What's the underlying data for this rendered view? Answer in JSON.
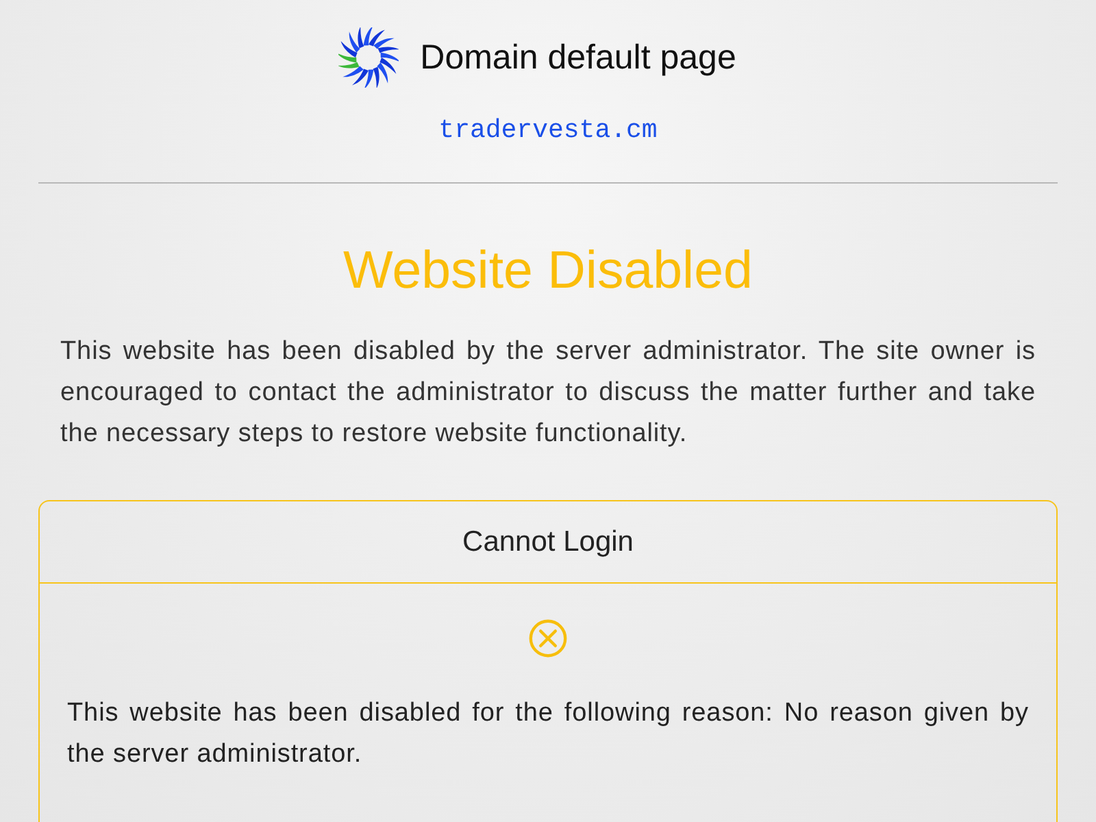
{
  "header": {
    "title": "Domain default page",
    "domain": "tradervesta.cm"
  },
  "heading": "Website Disabled",
  "message": "This website has been disabled by the server administrator. The site owner is encouraged to contact the administrator to discuss the matter further and take the necessary steps to restore website functionality.",
  "card": {
    "title": "Cannot Login",
    "text": "This website has been disabled for the following reason: No reason given by the server administrator."
  }
}
